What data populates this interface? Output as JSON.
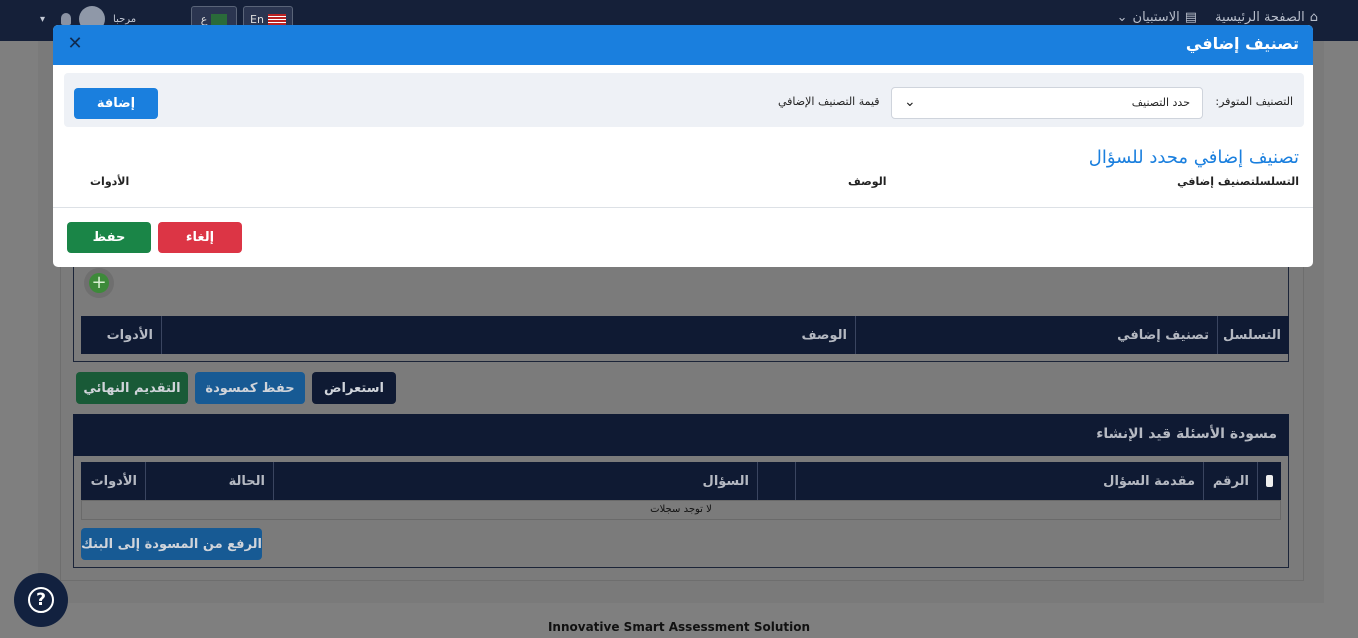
{
  "topbar": {
    "nav_home": "الصفحة الرئيسية",
    "nav_survey": "الاستبيان",
    "lang_en": "En",
    "lang_ar": "ع",
    "greeting": "مرحبا"
  },
  "background": {
    "table1": {
      "col_seq": "التسلسل",
      "col_class": "تصنيف إضافي",
      "col_desc": "الوصف",
      "col_tools": "الأدوات"
    },
    "btn_preview": "استعراض",
    "btn_save_draft": "حفظ كمسودة",
    "btn_final_submit": "التقديم النهائي",
    "draft_title": "مسودة الأسئلة قيد الإنشاء",
    "table2": {
      "col_num": "الرقم",
      "col_intro": "مقدمة السؤال",
      "col_question": "السؤال",
      "col_status": "الحالة",
      "col_tools": "الأدوات"
    },
    "no_records": "لا توجد سجلات",
    "btn_upload": "الرفع من المسودة إلى البنك",
    "footer": "Innovative Smart Assessment Solution"
  },
  "modal": {
    "title": "تصنيف إضافي",
    "label_available": "التصنيف المتوفر:",
    "select_value": "حدد التصنيف",
    "label_value": "قيمة التصنيف الإضافي",
    "btn_add": "إضافة",
    "section_title": "تصنيف إضافي محدد للسؤال",
    "col_seq_class": "التسلسلتصنيف إضافي",
    "col_desc": "الوصف",
    "col_tools": "الأدوات",
    "btn_cancel": "إلغاء",
    "btn_save": "حفظ"
  },
  "icons": {
    "close": "close-icon",
    "chevron": "chevron-down-icon",
    "plus": "plus-icon",
    "help": "help-icon"
  },
  "colors": {
    "primary": "#1a7fde",
    "success": "#1a8547",
    "danger": "#dc3545",
    "navy": "#0f1a33"
  }
}
